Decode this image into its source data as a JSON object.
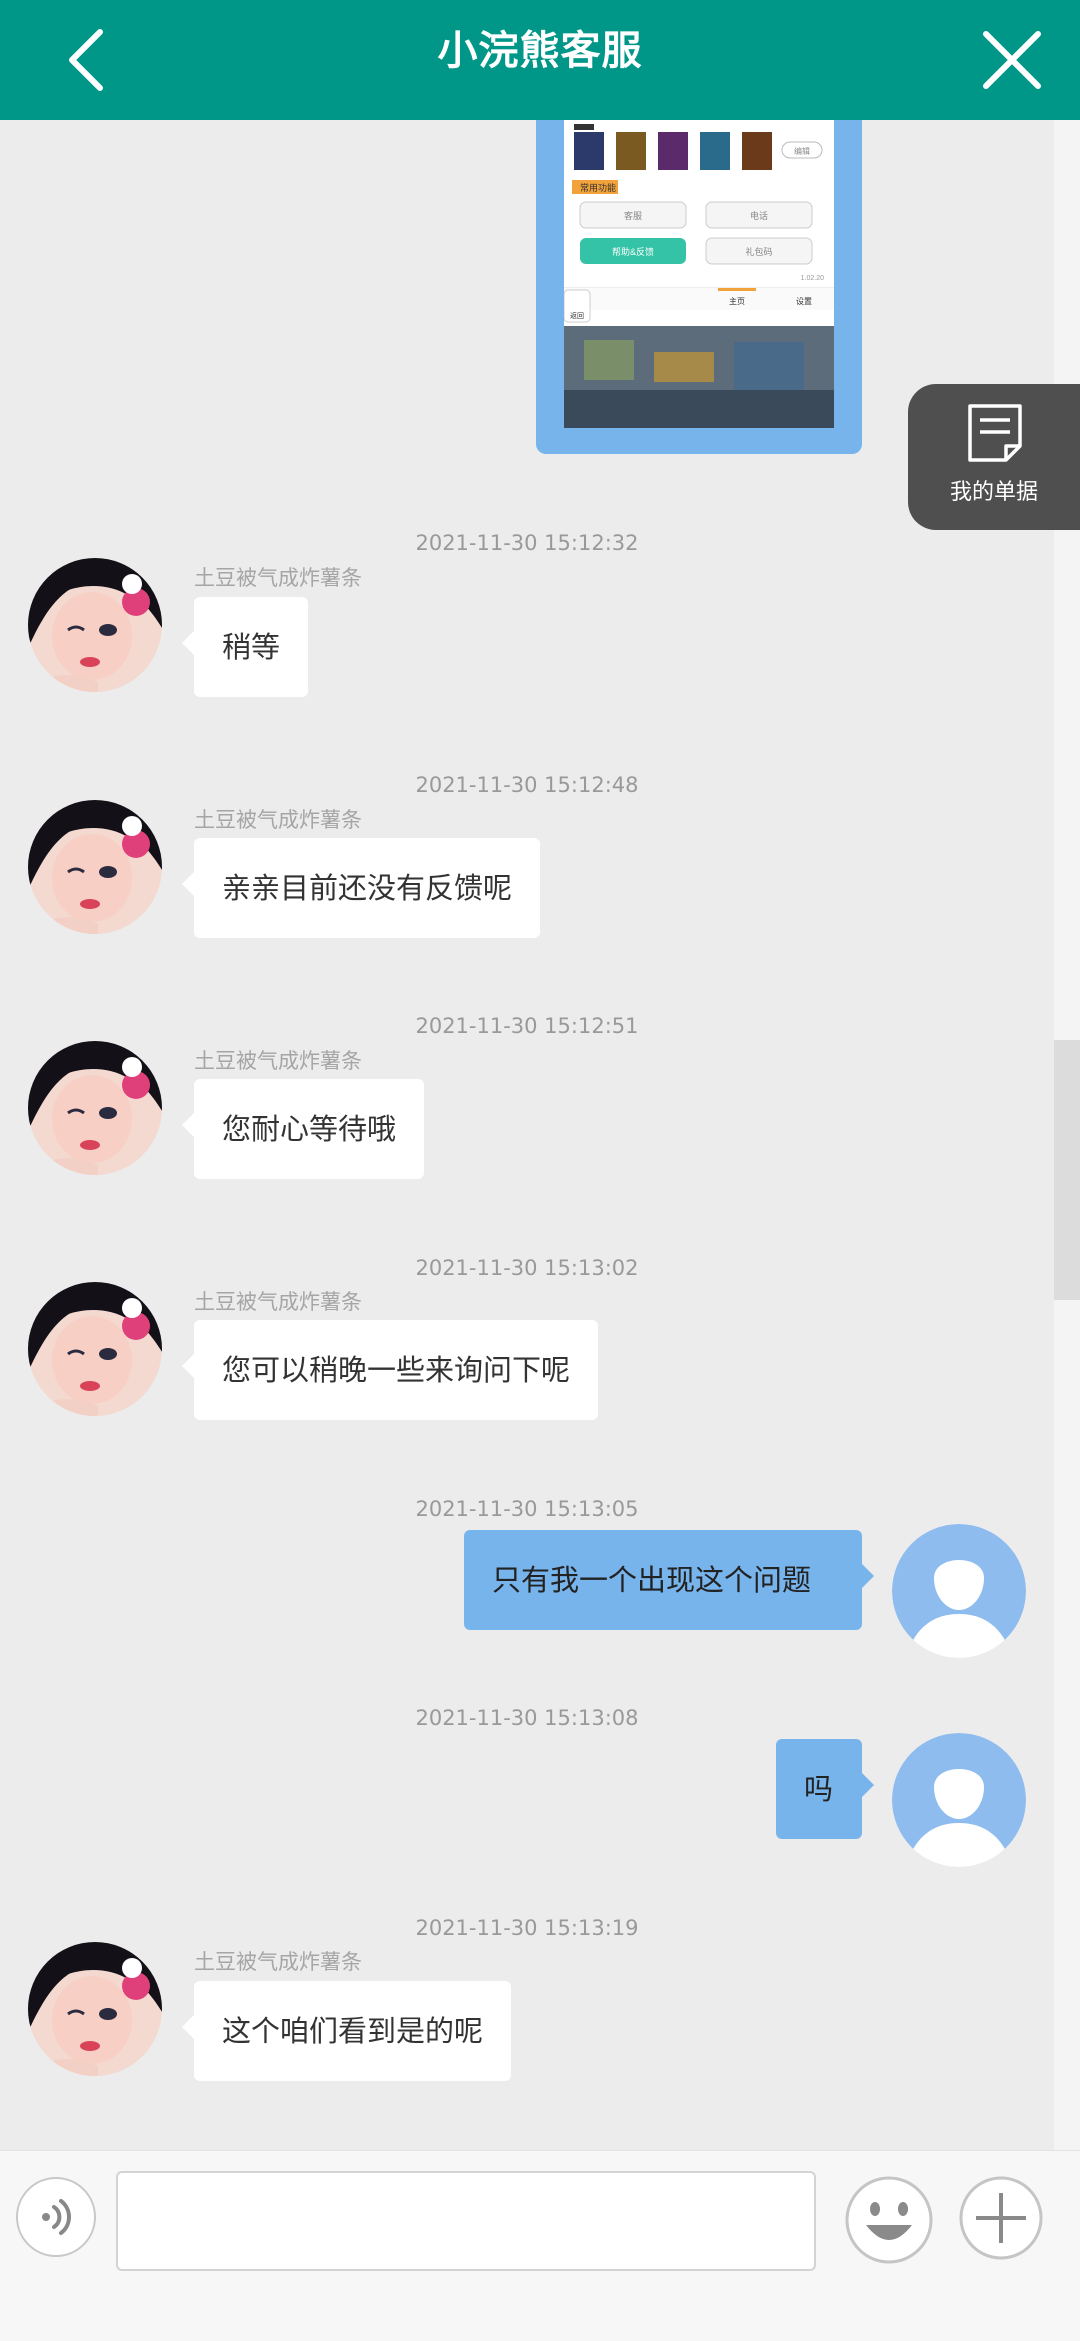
{
  "header": {
    "title": "小浣熊客服"
  },
  "float_button": {
    "label": "我的单据"
  },
  "image_message": {
    "section1": "常用功能",
    "edit_btn": "编辑",
    "btn1": "客服",
    "btn2": "电话",
    "btn3": "帮助&反馈",
    "btn4": "礼包码",
    "version": "1.02.20",
    "back_label": "返回",
    "tab1": "主页",
    "tab2": "设置"
  },
  "messages": [
    {
      "time": "2021-11-30 15:12:32",
      "nick": "土豆被气成炸薯条",
      "text": "稍等"
    },
    {
      "time": "2021-11-30 15:12:48",
      "nick": "土豆被气成炸薯条",
      "text": "亲亲目前还没有反馈呢"
    },
    {
      "time": "2021-11-30 15:12:51",
      "nick": "土豆被气成炸薯条",
      "text": "您耐心等待哦"
    },
    {
      "time": "2021-11-30 15:13:02",
      "nick": "土豆被气成炸薯条",
      "text": "您可以稍晚一些来询问下呢"
    },
    {
      "time": "2021-11-30 15:13:05",
      "text": "只有我一个出现这个问题"
    },
    {
      "time": "2021-11-30 15:13:08",
      "text": "吗"
    },
    {
      "time": "2021-11-30 15:13:19",
      "nick": "土豆被气成炸薯条",
      "text": "这个咱们看到是的呢"
    }
  ],
  "input": {
    "placeholder": ""
  },
  "colors": {
    "header": "#009688",
    "user_bubble": "#78b4ec",
    "background": "#ececec"
  }
}
